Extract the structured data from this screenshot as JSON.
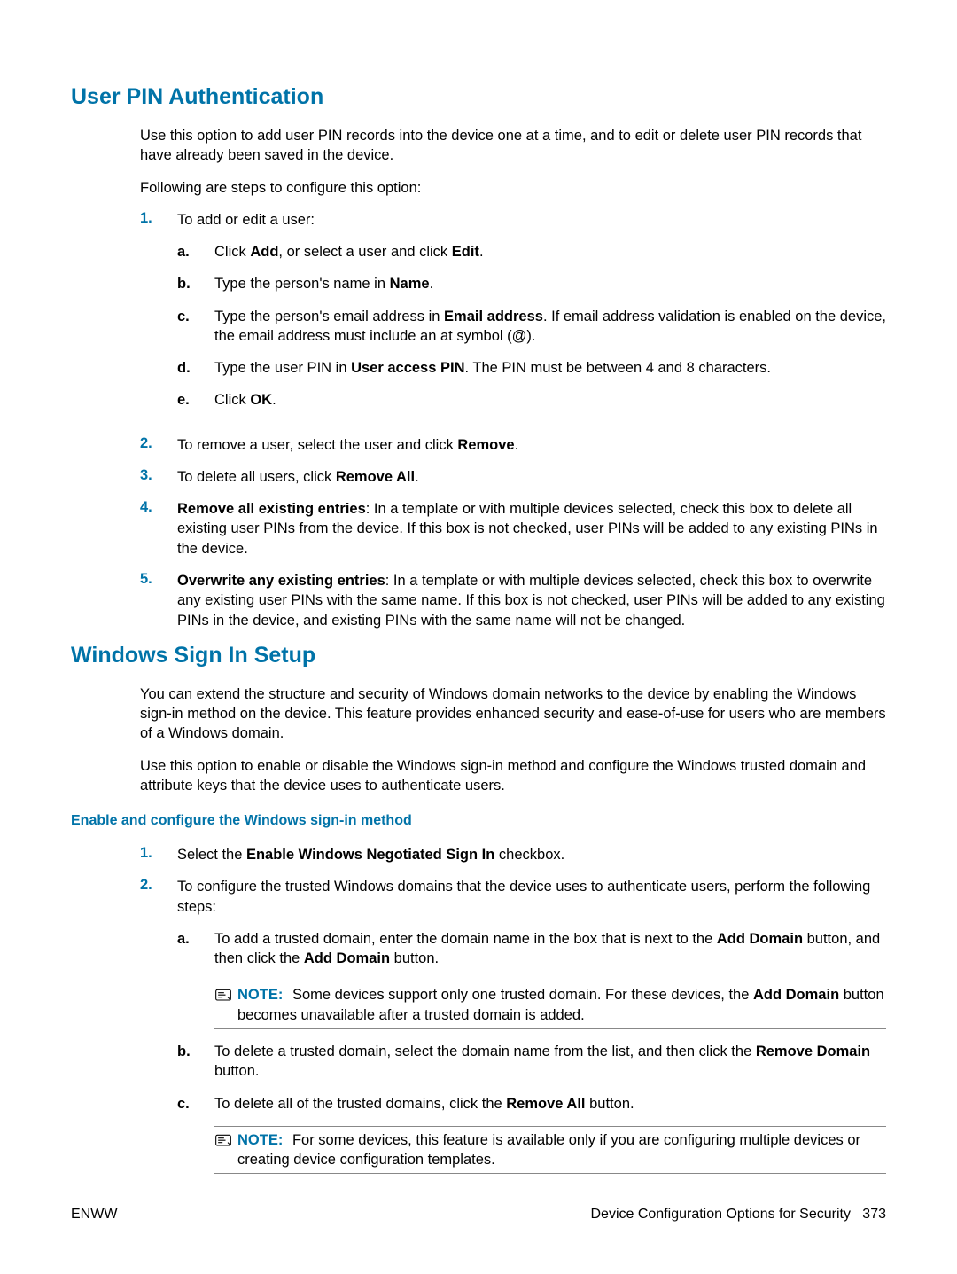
{
  "sections": {
    "userPin": {
      "title": "User PIN Authentication",
      "intro1": "Use this option to add user PIN records into the device one at a time, and to edit or delete user PIN records that have already been saved in the device.",
      "intro2": "Following are steps to configure this option:",
      "steps": {
        "s1": {
          "marker": "1.",
          "text": "To add or edit a user:",
          "sub": {
            "a": {
              "marker": "a.",
              "pre": "Click ",
              "b1": "Add",
              "mid": ", or select a user and click ",
              "b2": "Edit",
              "post": "."
            },
            "b": {
              "marker": "b.",
              "pre": "Type the person's name in ",
              "b1": "Name",
              "post": "."
            },
            "c": {
              "marker": "c.",
              "pre": "Type the person's email address in ",
              "b1": "Email address",
              "post": ". If email address validation is enabled on the device, the email address must include an at symbol (@)."
            },
            "d": {
              "marker": "d.",
              "pre": "Type the user PIN in ",
              "b1": "User access PIN",
              "post": ". The PIN must be between 4 and 8 characters."
            },
            "e": {
              "marker": "e.",
              "pre": "Click ",
              "b1": "OK",
              "post": "."
            }
          }
        },
        "s2": {
          "marker": "2.",
          "pre": "To remove a user, select the user and click ",
          "b1": "Remove",
          "post": "."
        },
        "s3": {
          "marker": "3.",
          "pre": "To delete all users, click ",
          "b1": "Remove All",
          "post": "."
        },
        "s4": {
          "marker": "4.",
          "b1": "Remove all existing entries",
          "post": ": In a template or with multiple devices selected, check this box to delete all existing user PINs from the device. If this box is not checked, user PINs will be added to any existing PINs in the device."
        },
        "s5": {
          "marker": "5.",
          "b1": "Overwrite any existing entries",
          "post": ": In a template or with multiple devices selected, check this box to overwrite any existing user PINs with the same name. If this box is not checked, user PINs will be added to any existing PINs in the device, and existing PINs with the same name will not be changed."
        }
      }
    },
    "winSignIn": {
      "title": "Windows Sign In Setup",
      "p1": "You can extend the structure and security of Windows domain networks to the device by enabling the Windows sign-in method on the device. This feature provides enhanced security and ease-of-use for users who are members of a Windows domain.",
      "p2": "Use this option to enable or disable the Windows sign-in method and configure the Windows trusted domain and attribute keys that the device uses to authenticate users.",
      "sub1": {
        "title": "Enable and configure the Windows sign-in method",
        "steps": {
          "s1": {
            "marker": "1.",
            "pre": "Select the ",
            "b1": "Enable Windows Negotiated Sign In",
            "post": " checkbox."
          },
          "s2": {
            "marker": "2.",
            "text": "To configure the trusted Windows domains that the device uses to authenticate users, perform the following steps:",
            "sub": {
              "a": {
                "marker": "a.",
                "pre": "To add a trusted domain, enter the domain name in the box that is next to the ",
                "b1": "Add Domain",
                "mid": " button, and then click the ",
                "b2": "Add Domain",
                "post": " button."
              },
              "note1": {
                "label": "NOTE:",
                "pre": "Some devices support only one trusted domain. For these devices, the ",
                "b1": "Add Domain",
                "post": " button becomes unavailable after a trusted domain is added."
              },
              "b": {
                "marker": "b.",
                "pre": "To delete a trusted domain, select the domain name from the list, and then click the ",
                "b1": "Remove Domain",
                "post": " button."
              },
              "c": {
                "marker": "c.",
                "pre": "To delete all of the trusted domains, click the ",
                "b1": "Remove All",
                "post": " button."
              },
              "note2": {
                "label": "NOTE:",
                "text": "For some devices, this feature is available only if you are configuring multiple devices or creating device configuration templates."
              }
            }
          }
        }
      }
    }
  },
  "footer": {
    "left": "ENWW",
    "rightLabel": "Device Configuration Options for Security",
    "pageNum": "373"
  }
}
